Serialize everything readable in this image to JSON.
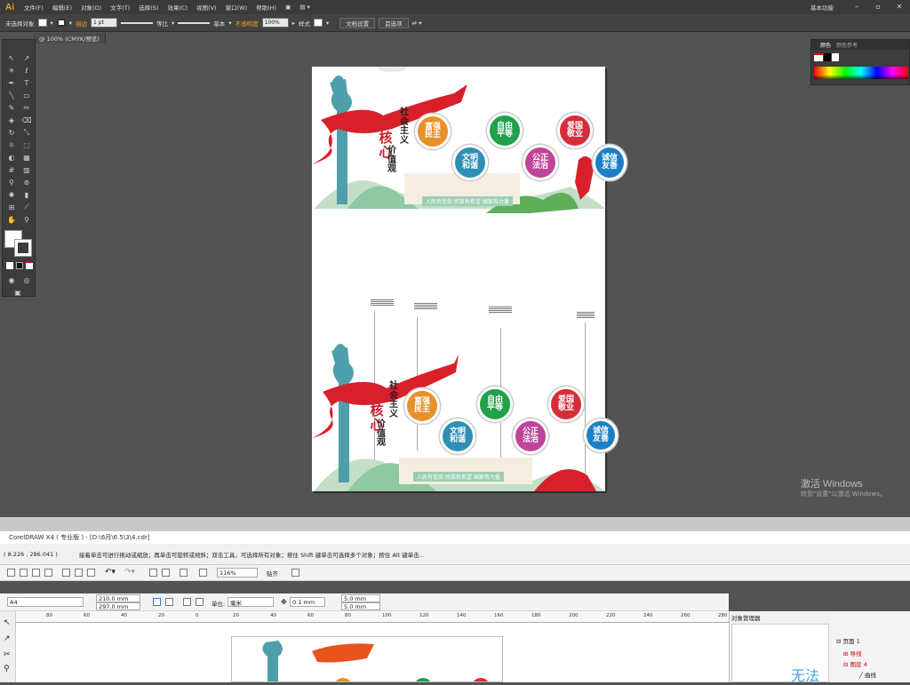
{
  "illustrator": {
    "logo": "Ai",
    "menus": [
      "文件(F)",
      "编辑(E)",
      "对象(O)",
      "文字(T)",
      "选择(S)",
      "效果(C)",
      "视图(V)",
      "窗口(W)",
      "帮助(H)"
    ],
    "workspace": "基本功能",
    "control": {
      "selection": "未选择对象",
      "stroke_label": "描边",
      "stroke_weight": "1 pt",
      "profile": "等比",
      "brush": "基本",
      "opacity_label": "不透明度",
      "opacity": "100%",
      "style_label": "样式",
      "doc_setup": "文档设置",
      "prefs": "首选项"
    },
    "doc_tab": "@ 100% (CMYK/预览)",
    "color_panel": {
      "tab1": "颜色",
      "tab2": "颜色参考"
    },
    "windows_watermark": {
      "line1": "激活 Windows",
      "line2": "转到\"设置\"以激活 Windows。"
    }
  },
  "artboard": {
    "panels": [
      {
        "title_top": "社会主义",
        "title_core": "核心",
        "title_bottom": "价值观",
        "tags": [
          {
            "text": "富强民主",
            "color": "#e8902a"
          },
          {
            "text": "文明和谐",
            "color": "#2f8fb4"
          },
          {
            "text": "自由平等",
            "color": "#22a04a"
          },
          {
            "text": "公正法治",
            "color": "#c04598"
          },
          {
            "text": "爱国敬业",
            "color": "#d62d3a"
          },
          {
            "text": "诚信友善",
            "color": "#1f7fc6"
          }
        ],
        "slogan": "人民有信仰  民族有希望  国家有力量"
      },
      {
        "title_top": "社会主义",
        "title_core": "核心",
        "title_bottom": "价值观",
        "tags": [
          {
            "text": "富强民主",
            "color": "#e8902a"
          },
          {
            "text": "文明和谐",
            "color": "#2f8fb4"
          },
          {
            "text": "自由平等",
            "color": "#22a04a"
          },
          {
            "text": "公正法治",
            "color": "#c04598"
          },
          {
            "text": "爱国敬业",
            "color": "#d62d3a"
          },
          {
            "text": "诚信友善",
            "color": "#1f7fc6"
          }
        ],
        "slogan": "人民有信仰  民族有希望  国家有力量"
      }
    ]
  },
  "coreldraw": {
    "title": "CorelDRAW X4 ( 专业版 ) - [D:\\6月\\6.5\\3\\4.cdr]",
    "coords": "( 8.226 , 286.041 )",
    "hint": "接着单击可进行拖动或缩放；再单击可旋转或倾斜；双击工具，可选择所有对象；按住 Shift 键单击可选择多个对象；按住 Alt 键单击...",
    "zoom": "116%",
    "snap_label": "贴齐",
    "page_size": "A4",
    "width": "210.0 mm",
    "height": "297.0 mm",
    "unit_label": "单位:",
    "unit": "毫米",
    "nudge": "0.1 mm",
    "dup_x": "5.0 mm",
    "dup_y": "5.0 mm",
    "ruler": [
      "80",
      "60",
      "40",
      "20",
      "0",
      "20",
      "40",
      "60",
      "80",
      "100",
      "120",
      "140",
      "160",
      "180",
      "200",
      "220",
      "240",
      "260",
      "280"
    ],
    "object_manager": "对象管理器",
    "side_text": "无法",
    "tree": {
      "page": "页面 1",
      "layer1": "导线",
      "layer2": "图层 4",
      "item": "曲线"
    }
  }
}
